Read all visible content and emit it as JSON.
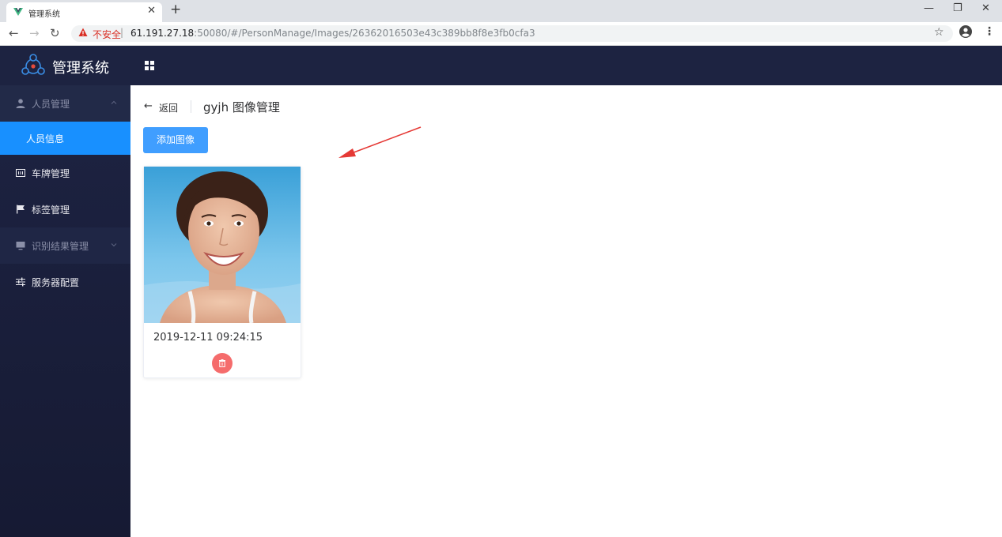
{
  "browser": {
    "tab_title": "管理系统",
    "not_secure": "不安全",
    "url_host": "61.191.27.18",
    "url_rest": ":50080/#/PersonManage/Images/26362016503e43c389bb8f8e3fb0cfa3"
  },
  "header": {
    "app_title": "管理系统"
  },
  "sidebar": {
    "items": [
      {
        "label": "人员管理",
        "icon": "person-icon",
        "state": "open"
      },
      {
        "label": "人员信息",
        "icon": "",
        "state": "active"
      },
      {
        "label": "车牌管理",
        "icon": "license-plate-icon",
        "state": "normal"
      },
      {
        "label": "标签管理",
        "icon": "flag-icon",
        "state": "normal"
      },
      {
        "label": "识别结果管理",
        "icon": "monitor-icon",
        "state": "collapsed"
      },
      {
        "label": "服务器配置",
        "icon": "sliders-icon",
        "state": "normal"
      }
    ]
  },
  "main": {
    "back_label": "返回",
    "page_title": "gyjh 图像管理",
    "add_button": "添加图像",
    "images": [
      {
        "date": "2019-12-11 09:24:15"
      }
    ]
  },
  "colors": {
    "header_bg": "#1d2341",
    "active_menu": "#1890ff",
    "primary_button": "#409eff",
    "delete_button": "#f56c6c",
    "annotation_arrow": "#e53935"
  }
}
